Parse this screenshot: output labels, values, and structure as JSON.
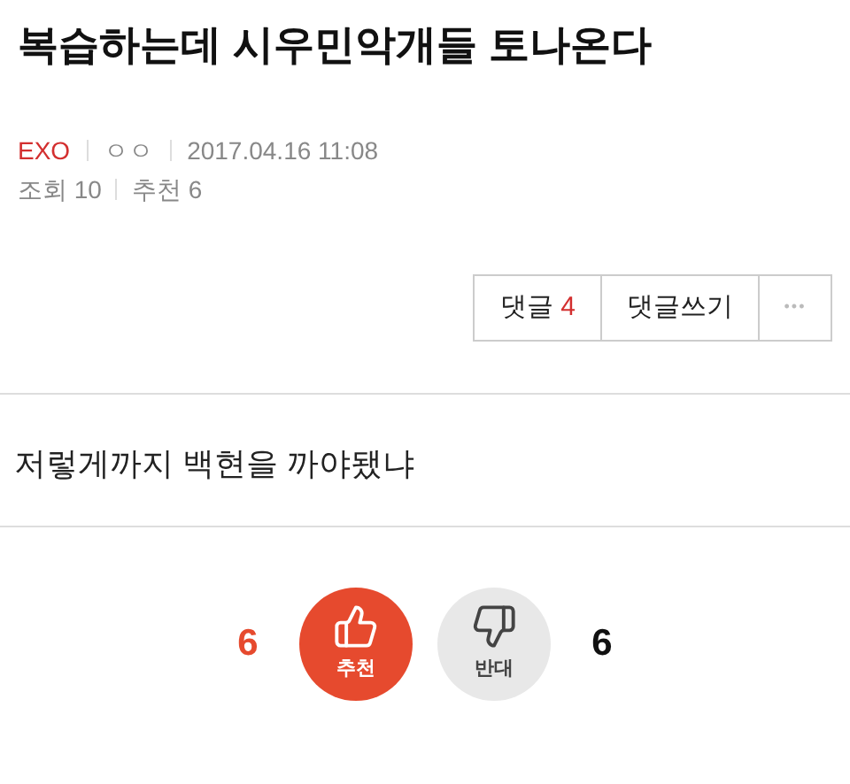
{
  "title": "복습하는데 시우민악개들 토나온다",
  "meta": {
    "category": "EXO",
    "author": "ㅇㅇ",
    "date": "2017.04.16 11:08",
    "views_label": "조회",
    "views": "10",
    "recommend_label": "추천",
    "recommend": "6"
  },
  "actions": {
    "comments_label": "댓글",
    "comments_count": "4",
    "write_comment": "댓글쓰기",
    "more": "•••"
  },
  "body": "저렇게까지 백현을 까야됐냐",
  "votes": {
    "up_count": "6",
    "up_label": "추천",
    "down_label": "반대",
    "down_count": "6"
  }
}
